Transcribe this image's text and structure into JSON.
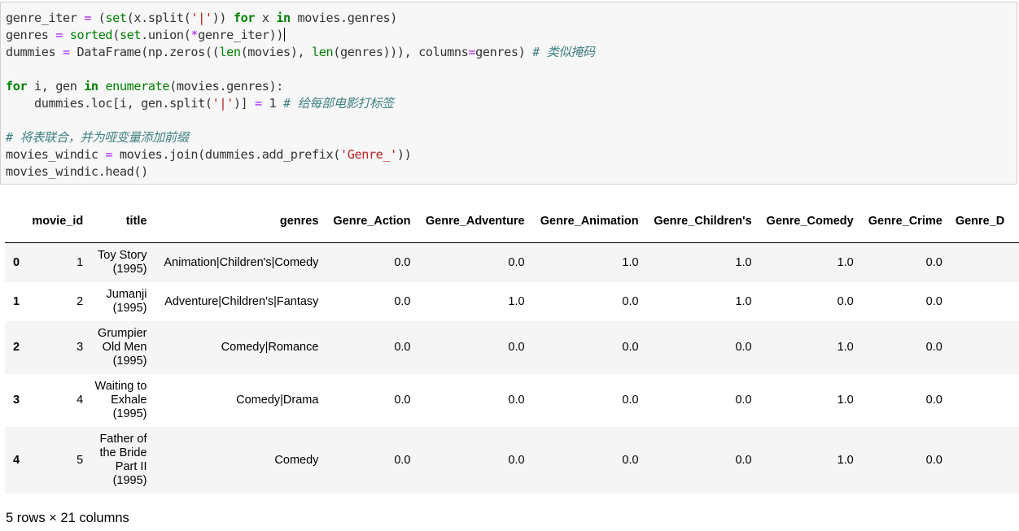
{
  "code_lines": [
    "genre_iter = (set(x.split('|')) for x in movies.genres)",
    "genres = sorted(set.union(*genre_iter))",
    "dummies = DataFrame(np.zeros((len(movies), len(genres))), columns=genres) # 类似掩码",
    "",
    "for i, gen in enumerate(movies.genres):",
    "    dummies.loc[i, gen.split('|')] = 1 # 给每部电影打标签",
    "",
    "# 将表联合，并为哑变量添加前缀",
    "movies_windic = movies.join(dummies.add_prefix('Genre_'))",
    "movies_windic.head()"
  ],
  "table": {
    "columns": [
      "movie_id",
      "title",
      "genres",
      "Genre_Action",
      "Genre_Adventure",
      "Genre_Animation",
      "Genre_Children's",
      "Genre_Comedy",
      "Genre_Crime",
      "Genre_D"
    ],
    "rows": [
      {
        "index": "0",
        "movie_id": "1",
        "title": "Toy Story (1995)",
        "genres": "Animation|Children's|Comedy",
        "values": [
          "0.0",
          "0.0",
          "1.0",
          "1.0",
          "1.0",
          "0.0"
        ]
      },
      {
        "index": "1",
        "movie_id": "2",
        "title": "Jumanji (1995)",
        "genres": "Adventure|Children's|Fantasy",
        "values": [
          "0.0",
          "1.0",
          "0.0",
          "1.0",
          "0.0",
          "0.0"
        ]
      },
      {
        "index": "2",
        "movie_id": "3",
        "title": "Grumpier Old Men (1995)",
        "genres": "Comedy|Romance",
        "values": [
          "0.0",
          "0.0",
          "0.0",
          "0.0",
          "1.0",
          "0.0"
        ]
      },
      {
        "index": "3",
        "movie_id": "4",
        "title": "Waiting to Exhale (1995)",
        "genres": "Comedy|Drama",
        "values": [
          "0.0",
          "0.0",
          "0.0",
          "0.0",
          "1.0",
          "0.0"
        ]
      },
      {
        "index": "4",
        "movie_id": "5",
        "title": "Father of the Bride Part II (1995)",
        "genres": "Comedy",
        "values": [
          "0.0",
          "0.0",
          "0.0",
          "0.0",
          "1.0",
          "0.0"
        ]
      }
    ]
  },
  "footer": "5 rows × 21 columns"
}
